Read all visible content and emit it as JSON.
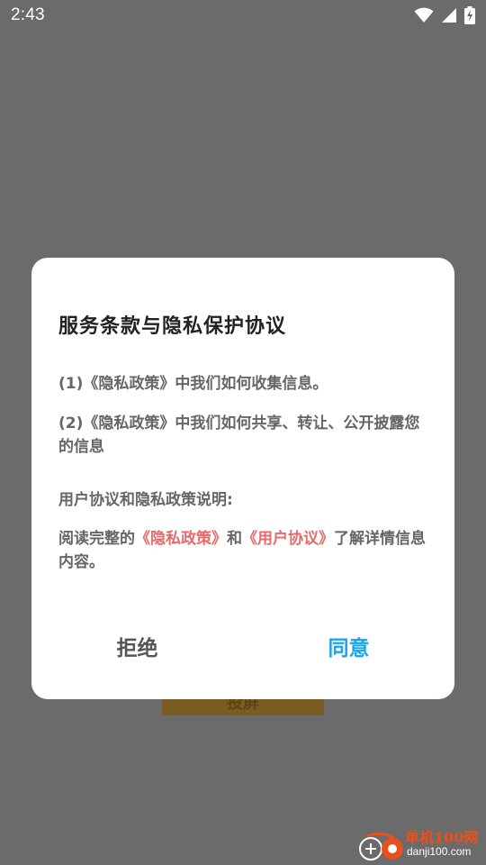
{
  "status_bar": {
    "time": "2:43",
    "icons": [
      "wifi-icon",
      "signal-icon",
      "battery-charging-icon"
    ]
  },
  "background": {
    "button_label": "投屏"
  },
  "dialog": {
    "title": "服务条款与隐私保护协议",
    "paragraph1": "(1)《隐私政策》中我们如何收集信息。",
    "paragraph2": "(2)《隐私政策》中我们如何共享、转让、公开披露您的信息",
    "paragraph3": "用户协议和隐私政策说明:",
    "paragraph4": {
      "prefix": "阅读完整的",
      "privacy_link": "《隐私政策》",
      "conjunction": "和",
      "user_link": "《用户协议》",
      "suffix": "了解详情信息内容。"
    },
    "reject_label": "拒绝",
    "agree_label": "同意"
  },
  "watermark": {
    "brand_cn": "单机100网",
    "brand_url": "danji100.com"
  },
  "colors": {
    "overlay": "#6b6b6b",
    "dialog_bg": "#ffffff",
    "link": "#e66a6a",
    "agree": "#1aa3e8",
    "reject": "#555555"
  }
}
